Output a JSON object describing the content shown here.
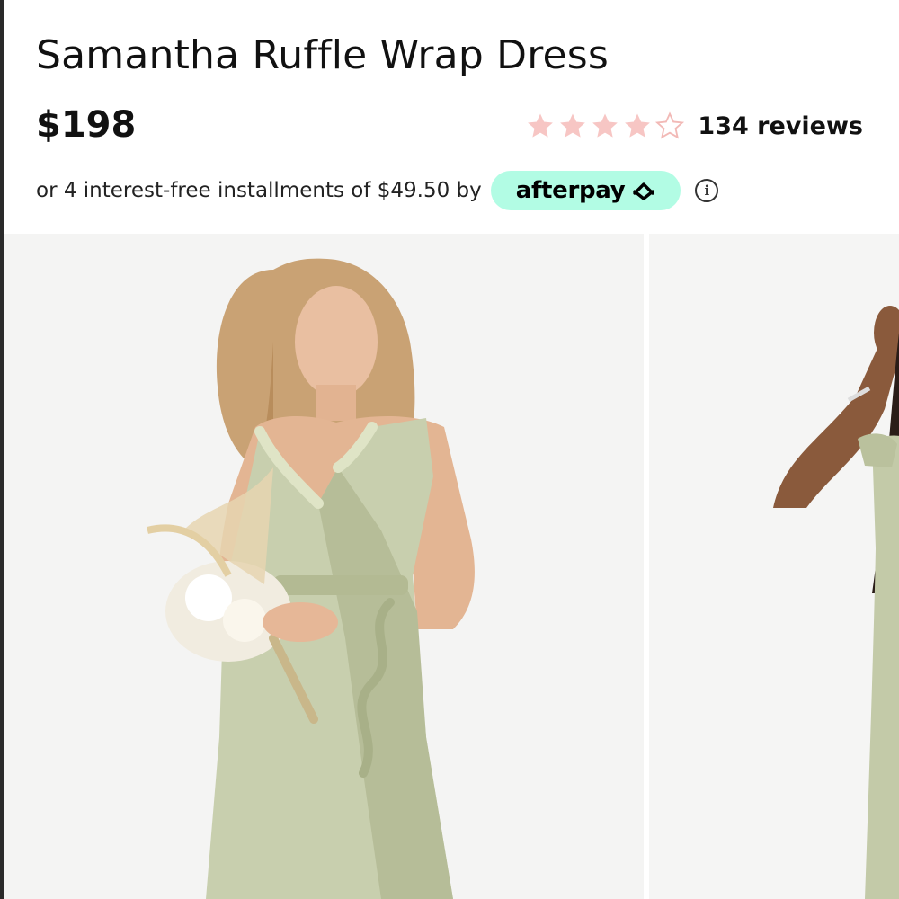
{
  "product": {
    "title": "Samantha Ruffle Wrap Dress",
    "price": "$198",
    "rating": {
      "stars_filled": 4,
      "stars_total": 5,
      "reviews_label": "134 reviews",
      "star_color": "#f7c6c4"
    },
    "installments": {
      "text": "or 4 interest-free installments of $49.50 by",
      "provider": "afterpay",
      "badge_color": "#b2fce4"
    }
  },
  "gallery": {
    "images": [
      {
        "name": "model-front-sage-dress"
      },
      {
        "name": "model-side-sage-dress"
      }
    ],
    "dress_color": "#c8cfae"
  }
}
